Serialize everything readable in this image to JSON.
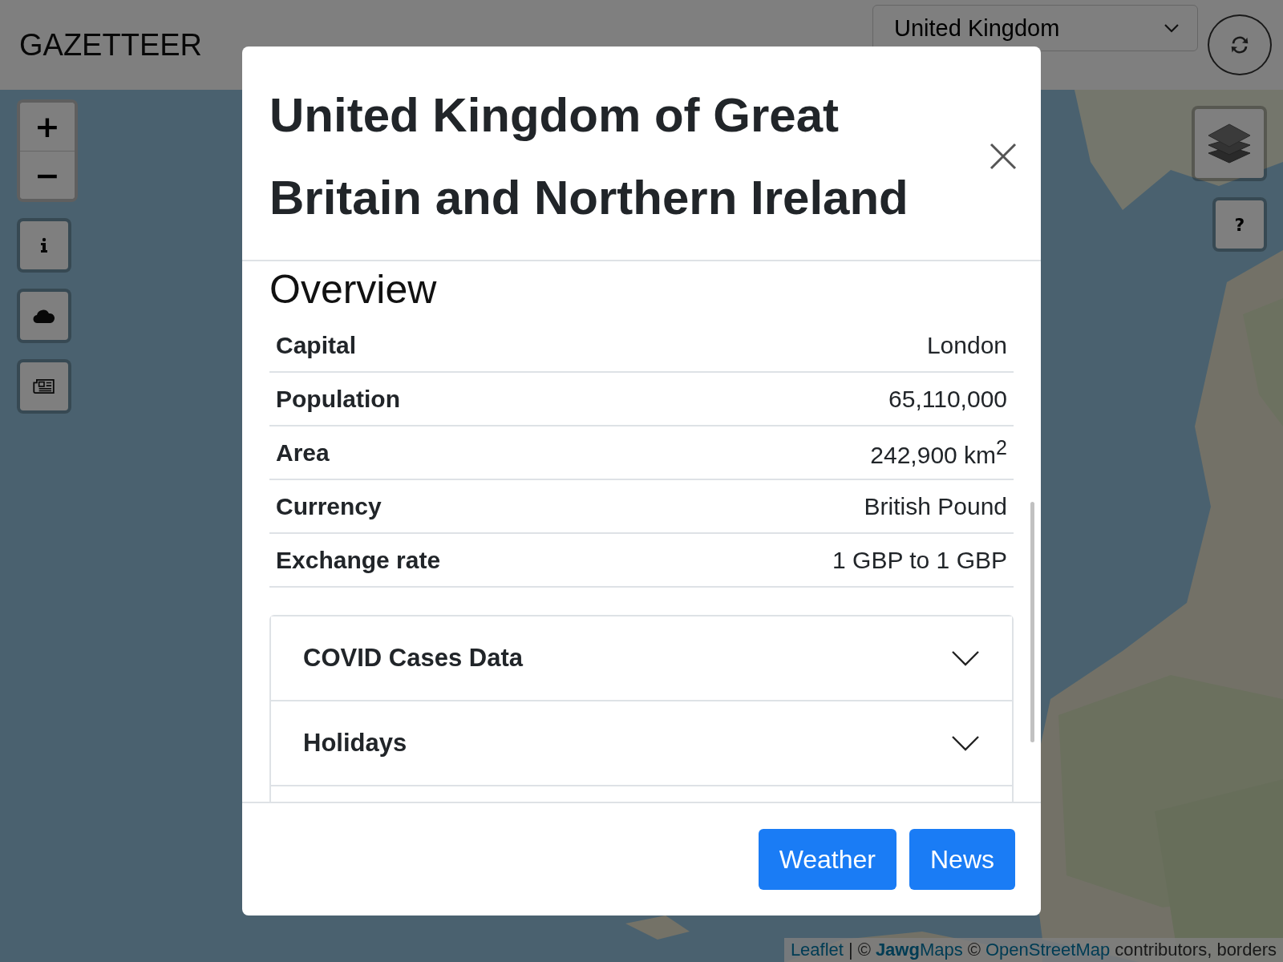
{
  "navbar": {
    "brand": "GAZETTEER",
    "country_select": {
      "value": "United Kingdom"
    }
  },
  "map_controls": {
    "zoom_in": "+",
    "zoom_out": "−",
    "left_buttons": [
      {
        "kind": "info"
      },
      {
        "kind": "weather"
      },
      {
        "kind": "news"
      }
    ],
    "help": "?"
  },
  "attribution": [
    {
      "kind": "link",
      "text": "Leaflet"
    },
    {
      "kind": "text",
      "text": "|"
    },
    {
      "kind": "text",
      "text": "©"
    },
    {
      "kind": "link",
      "text": "**Jawg**Maps"
    },
    {
      "kind": "text",
      "text": "©"
    },
    {
      "kind": "link",
      "text": "OpenStreetMap"
    },
    {
      "kind": "text",
      "text": "contributors, borders"
    }
  ],
  "modal": {
    "title": "United Kingdom of Great Britain and Northern Ireland",
    "section": "Overview",
    "rows": [
      {
        "label": "Capital",
        "value": "London"
      },
      {
        "label": "Population",
        "value": "65,110,000"
      },
      {
        "label": "Area",
        "value": "242,900 km$^{2}$"
      },
      {
        "label": "Currency",
        "value": "British Pound"
      },
      {
        "label": "Exchange rate",
        "value": "1 GBP to 1 GBP"
      }
    ],
    "accordion": [
      {
        "title": "COVID Cases Data",
        "expanded": false
      },
      {
        "title": "Holidays",
        "expanded": false
      }
    ],
    "buttons": [
      "Weather",
      "News"
    ]
  }
}
